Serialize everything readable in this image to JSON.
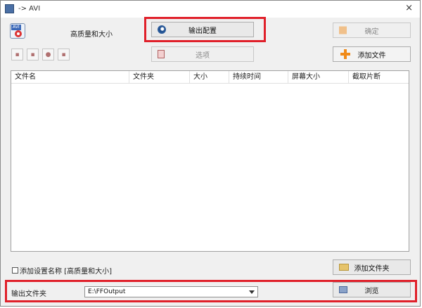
{
  "window": {
    "title": "-> AVI",
    "close_glyph": "×"
  },
  "profile": {
    "icon_tag": "AVI",
    "name": "高质量和大小"
  },
  "buttons": {
    "output_config": "输出配置",
    "ok": "确定",
    "options": "选项",
    "add_file": "添加文件",
    "add_folder": "添加文件夹",
    "browse": "浏览"
  },
  "toolbar": {
    "tool_glyphs": [
      "▪",
      "▪",
      "●",
      "▪"
    ]
  },
  "file_list": {
    "columns": [
      "文件名",
      "文件夹",
      "大小",
      "持续时间",
      "屏幕大小",
      "截取片断"
    ],
    "rows": []
  },
  "add_setting_name": {
    "label": "添加设置名称 [高质量和大小]",
    "checked": false
  },
  "output": {
    "label": "输出文件夹",
    "path": "E:\\FFOutput"
  },
  "colors": {
    "highlight": "#e0202a",
    "accent_orange": "#f08a18"
  },
  "icons": {
    "app": "app-icon",
    "profile": "avi-profile-icon",
    "output_config": "disc-icon",
    "ok": "arrow-icon",
    "options": "options-icon",
    "add_file": "plus-icon",
    "add_folder": "folder-icon",
    "browse": "browse-icon"
  }
}
